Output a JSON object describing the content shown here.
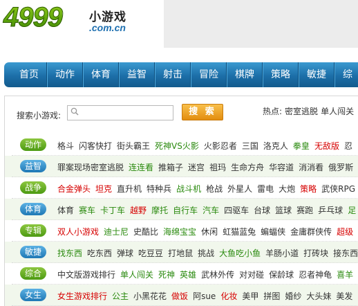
{
  "logo": {
    "number": "4999",
    "cn": "小游戏",
    "domain": ".com.cn"
  },
  "nav": [
    "首页",
    "动作",
    "体育",
    "益智",
    "射击",
    "冒险",
    "棋牌",
    "策略",
    "敏捷",
    "综"
  ],
  "search": {
    "label": "搜索小游戏:",
    "placeholder": "",
    "button": "搜 索",
    "hot_label": "热点:",
    "hot_links": [
      "密室逃脱",
      "单人闯关"
    ]
  },
  "colors": {
    "green": "#2a8a0e",
    "red": "#d60000",
    "normal": "#333333"
  },
  "categories": [
    {
      "label": "动作",
      "badge": "green",
      "games": [
        {
          "t": "格斗",
          "c": "n"
        },
        {
          "t": "闪客快打",
          "c": "n"
        },
        {
          "t": "街头霸王",
          "c": "n"
        },
        {
          "t": "死神VS火影",
          "c": "g"
        },
        {
          "t": "火影忍者",
          "c": "n"
        },
        {
          "t": "三国",
          "c": "n"
        },
        {
          "t": "洛克人",
          "c": "n"
        },
        {
          "t": "拳皇",
          "c": "g"
        },
        {
          "t": "无敌版",
          "c": "r"
        },
        {
          "t": "忍",
          "c": "n"
        }
      ]
    },
    {
      "label": "益智",
      "badge": "blue",
      "games": [
        {
          "t": "罪案现场密室逃脱",
          "c": "n"
        },
        {
          "t": "连连看",
          "c": "g"
        },
        {
          "t": "推箱子",
          "c": "n"
        },
        {
          "t": "迷宫",
          "c": "n"
        },
        {
          "t": "祖玛",
          "c": "n"
        },
        {
          "t": "生命方舟",
          "c": "n"
        },
        {
          "t": "华容道",
          "c": "n"
        },
        {
          "t": "消消看",
          "c": "n"
        },
        {
          "t": "俄罗斯",
          "c": "n"
        }
      ]
    },
    {
      "label": "战争",
      "badge": "green",
      "games": [
        {
          "t": "合金弹头",
          "c": "r"
        },
        {
          "t": "坦克",
          "c": "r"
        },
        {
          "t": "直升机",
          "c": "n"
        },
        {
          "t": "特种兵",
          "c": "n"
        },
        {
          "t": "战斗机",
          "c": "g"
        },
        {
          "t": "枪战",
          "c": "n"
        },
        {
          "t": "外星人",
          "c": "n"
        },
        {
          "t": "雷电",
          "c": "n"
        },
        {
          "t": "大炮",
          "c": "n"
        },
        {
          "t": "策略",
          "c": "r"
        },
        {
          "t": "武侠RPG",
          "c": "n"
        }
      ]
    },
    {
      "label": "体育",
      "badge": "blue",
      "games": [
        {
          "t": "体育",
          "c": "n"
        },
        {
          "t": "赛车",
          "c": "g"
        },
        {
          "t": "卡丁车",
          "c": "g"
        },
        {
          "t": "越野",
          "c": "r"
        },
        {
          "t": "摩托",
          "c": "g"
        },
        {
          "t": "自行车",
          "c": "g"
        },
        {
          "t": "汽车",
          "c": "g"
        },
        {
          "t": "四驱车",
          "c": "n"
        },
        {
          "t": "台球",
          "c": "n"
        },
        {
          "t": "篮球",
          "c": "n"
        },
        {
          "t": "赛跑",
          "c": "n"
        },
        {
          "t": "乒乓球",
          "c": "n"
        },
        {
          "t": "足",
          "c": "g"
        }
      ]
    },
    {
      "label": "专辑",
      "badge": "green",
      "games": [
        {
          "t": "双人小游戏",
          "c": "r"
        },
        {
          "t": "迪士尼",
          "c": "g"
        },
        {
          "t": "史酷比",
          "c": "n"
        },
        {
          "t": "海绵宝宝",
          "c": "g"
        },
        {
          "t": "休闲",
          "c": "n"
        },
        {
          "t": "虹猫蓝兔",
          "c": "n"
        },
        {
          "t": "蝙蝠侠",
          "c": "n"
        },
        {
          "t": "金庸群侠传",
          "c": "n"
        },
        {
          "t": "超级",
          "c": "r"
        }
      ]
    },
    {
      "label": "敏捷",
      "badge": "blue",
      "games": [
        {
          "t": "找东西",
          "c": "g"
        },
        {
          "t": "吃东西",
          "c": "n"
        },
        {
          "t": "弹球",
          "c": "n"
        },
        {
          "t": "吃豆豆",
          "c": "n"
        },
        {
          "t": "打地鼠",
          "c": "n"
        },
        {
          "t": "挑战",
          "c": "n"
        },
        {
          "t": "大鱼吃小鱼",
          "c": "g"
        },
        {
          "t": "羊肠小道",
          "c": "n"
        },
        {
          "t": "打砖块",
          "c": "n"
        },
        {
          "t": "接东西",
          "c": "n"
        }
      ]
    },
    {
      "label": "综合",
      "badge": "green",
      "games": [
        {
          "t": "中文版游戏排行",
          "c": "n"
        },
        {
          "t": "单人闯关",
          "c": "g"
        },
        {
          "t": "死神",
          "c": "g"
        },
        {
          "t": "英雄",
          "c": "g"
        },
        {
          "t": "武林外传",
          "c": "n"
        },
        {
          "t": "对对碰",
          "c": "n"
        },
        {
          "t": "保龄球",
          "c": "n"
        },
        {
          "t": "忍者神龟",
          "c": "n"
        },
        {
          "t": "喜羊",
          "c": "g"
        }
      ]
    },
    {
      "label": "女生",
      "badge": "blue",
      "games": [
        {
          "t": "女生游戏排行",
          "c": "r"
        },
        {
          "t": "公主",
          "c": "g"
        },
        {
          "t": "小黑花花",
          "c": "n"
        },
        {
          "t": "做饭",
          "c": "r"
        },
        {
          "t": "阿sue",
          "c": "n"
        },
        {
          "t": "化妆",
          "c": "r"
        },
        {
          "t": "美甲",
          "c": "n"
        },
        {
          "t": "拼图",
          "c": "n"
        },
        {
          "t": "婚纱",
          "c": "n"
        },
        {
          "t": "大头妹",
          "c": "n"
        },
        {
          "t": "美发",
          "c": "n"
        }
      ]
    }
  ]
}
